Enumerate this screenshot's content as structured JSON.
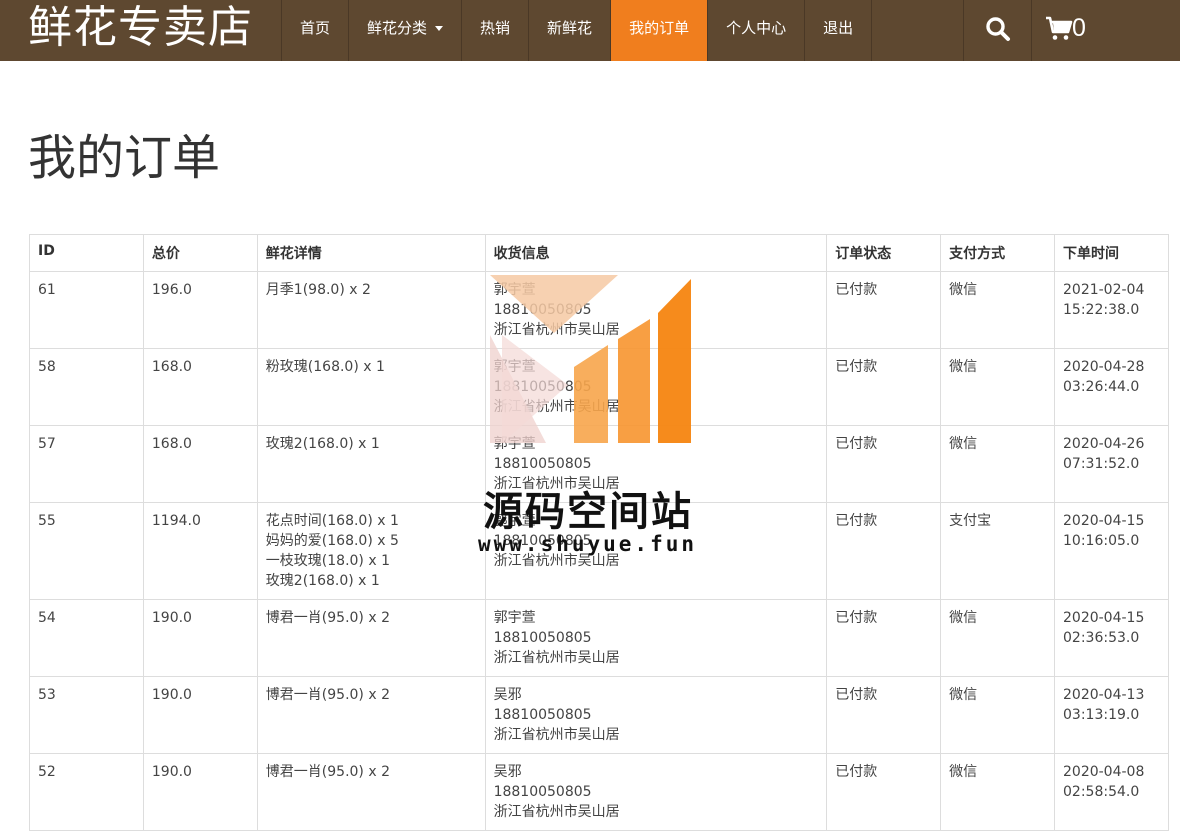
{
  "header": {
    "brand": "鲜花专卖店",
    "nav": [
      {
        "label": "首页"
      },
      {
        "label": "鲜花分类"
      },
      {
        "label": "热销"
      },
      {
        "label": "新鲜花"
      },
      {
        "label": "我的订单"
      },
      {
        "label": "个人中心"
      },
      {
        "label": "退出"
      }
    ],
    "active_nav": "我的订单",
    "cart_count": "0",
    "accent_color": "#f07e1e",
    "bar_color": "#5e4830"
  },
  "page": {
    "title": "我的订单"
  },
  "table": {
    "headers": [
      "ID",
      "总价",
      "鲜花详情",
      "收货信息",
      "订单状态",
      "支付方式",
      "下单时间"
    ],
    "rows": [
      {
        "id": "61",
        "total": "196.0",
        "items": [
          "月季1(98.0) x 2"
        ],
        "receiver": [
          "郭宇萱",
          "18810050805",
          "浙江省杭州市吴山居"
        ],
        "status": "已付款",
        "payment": "微信",
        "date": "2021-02-04",
        "time": "15:22:38.0"
      },
      {
        "id": "58",
        "total": "168.0",
        "items": [
          "粉玫瑰(168.0) x 1"
        ],
        "receiver": [
          "郭宇萱",
          "18810050805",
          "浙江省杭州市吴山居"
        ],
        "status": "已付款",
        "payment": "微信",
        "date": "2020-04-28",
        "time": "03:26:44.0"
      },
      {
        "id": "57",
        "total": "168.0",
        "items": [
          "玫瑰2(168.0) x 1"
        ],
        "receiver": [
          "郭宇萱",
          "18810050805",
          "浙江省杭州市吴山居"
        ],
        "status": "已付款",
        "payment": "微信",
        "date": "2020-04-26",
        "time": "07:31:52.0"
      },
      {
        "id": "55",
        "total": "1194.0",
        "items": [
          "花点时间(168.0) x 1",
          "妈妈的爱(168.0) x 5",
          "一枝玫瑰(18.0) x 1",
          "玫瑰2(168.0) x 1"
        ],
        "receiver": [
          "郭宇萱",
          "18810050805",
          "浙江省杭州市吴山居"
        ],
        "status": "已付款",
        "payment": "支付宝",
        "date": "2020-04-15",
        "time": "10:16:05.0"
      },
      {
        "id": "54",
        "total": "190.0",
        "items": [
          "博君一肖(95.0) x 2"
        ],
        "receiver": [
          "郭宇萱",
          "18810050805",
          "浙江省杭州市吴山居"
        ],
        "status": "已付款",
        "payment": "微信",
        "date": "2020-04-15",
        "time": "02:36:53.0"
      },
      {
        "id": "53",
        "total": "190.0",
        "items": [
          "博君一肖(95.0) x 2"
        ],
        "receiver": [
          "吴邪",
          "18810050805",
          "浙江省杭州市吴山居"
        ],
        "status": "已付款",
        "payment": "微信",
        "date": "2020-04-13",
        "time": "03:13:19.0"
      },
      {
        "id": "52",
        "total": "190.0",
        "items": [
          "博君一肖(95.0) x 2"
        ],
        "receiver": [
          "吴邪",
          "18810050805",
          "浙江省杭州市吴山居"
        ],
        "status": "已付款",
        "payment": "微信",
        "date": "2020-04-08",
        "time": "02:58:54.0"
      }
    ]
  },
  "watermark": {
    "title": "源码空间站",
    "url": "www.shuyue.fun"
  }
}
